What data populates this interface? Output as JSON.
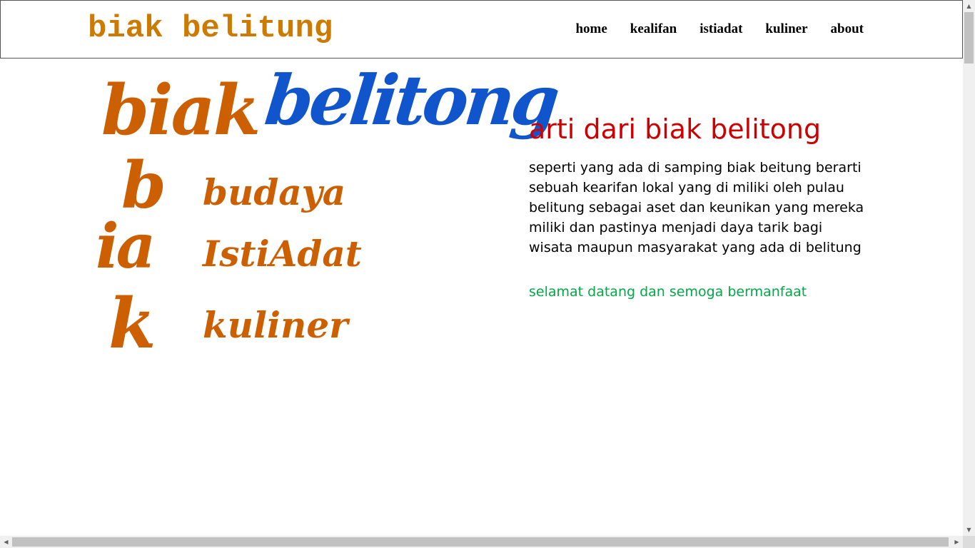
{
  "header": {
    "site_title": "biak belitung",
    "nav": [
      {
        "label": "home"
      },
      {
        "label": "kealifan"
      },
      {
        "label": "istiadat"
      },
      {
        "label": "kuliner"
      },
      {
        "label": "about"
      }
    ]
  },
  "logo": {
    "biak": "biak",
    "belitong": "belitong",
    "letters": [
      "b",
      "ia",
      "k"
    ],
    "words": [
      "budaya",
      "IstiAdat",
      "kuliner"
    ],
    "colors": {
      "orange": "#cc6000",
      "blue": "#1155cc"
    }
  },
  "content": {
    "title": "arti dari biak belitong",
    "body": "seperti yang ada di samping biak beitung berarti sebuah kearifan lokal yang di miliki oleh pulau belitung sebagai aset dan keunikan yang mereka miliki dan pastinya menjadi daya tarik bagi wisata maupun masyarakat yang ada di belitung",
    "welcome": "selamat datang dan semoga bermanfaat"
  },
  "colors": {
    "title_orange": "#cc7a00",
    "heading_red": "#cc0000",
    "welcome_green": "#00aa44"
  },
  "scrollbars": {
    "up_icon": "▲",
    "down_icon": "▼",
    "left_icon": "◀",
    "right_icon": "▶"
  }
}
